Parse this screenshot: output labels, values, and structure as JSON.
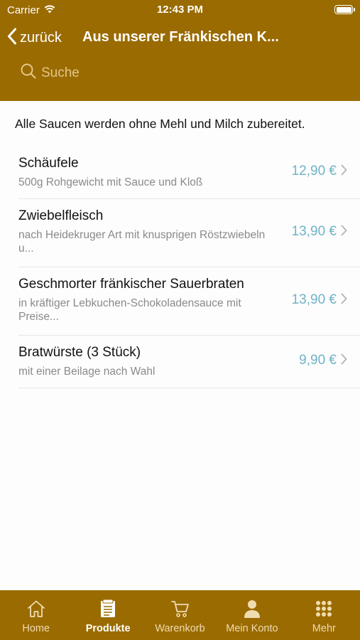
{
  "status_bar": {
    "carrier": "Carrier",
    "time": "12:43 PM"
  },
  "nav": {
    "back_label": "zurück",
    "title": "Aus unserer Fränkischen K..."
  },
  "search": {
    "placeholder": "Suche"
  },
  "info_text": "Alle Saucen werden ohne Mehl und Milch zubereitet.",
  "items": [
    {
      "name": "Schäufele",
      "description": "500g Rohgewicht mit Sauce und Kloß",
      "price": "12,90 €"
    },
    {
      "name": "Zwiebelfleisch",
      "description": "nach Heidekruger Art mit knusprigen Röstzwiebeln u...",
      "price": "13,90 €"
    },
    {
      "name": "Geschmorter fränkischer Sauerbraten",
      "description": "in kräftiger Lebkuchen-Schokoladensauce mit Preise...",
      "price": "13,90 €"
    },
    {
      "name": "Bratwürste (3 Stück)",
      "description": "mit einer Beilage nach Wahl",
      "price": "9,90 €"
    }
  ],
  "tabs": [
    {
      "label": "Home",
      "icon": "home-icon",
      "active": false
    },
    {
      "label": "Produkte",
      "icon": "menu-card-icon",
      "active": true
    },
    {
      "label": "Warenkorb",
      "icon": "cart-icon",
      "active": false
    },
    {
      "label": "Mein Konto",
      "icon": "person-icon",
      "active": false
    },
    {
      "label": "Mehr",
      "icon": "grid-icon",
      "active": false
    }
  ],
  "colors": {
    "brand": "#9a6b00",
    "price": "#6fb3c6",
    "search_placeholder": "#e3c68a",
    "tab_inactive": "#f0dcb1"
  }
}
